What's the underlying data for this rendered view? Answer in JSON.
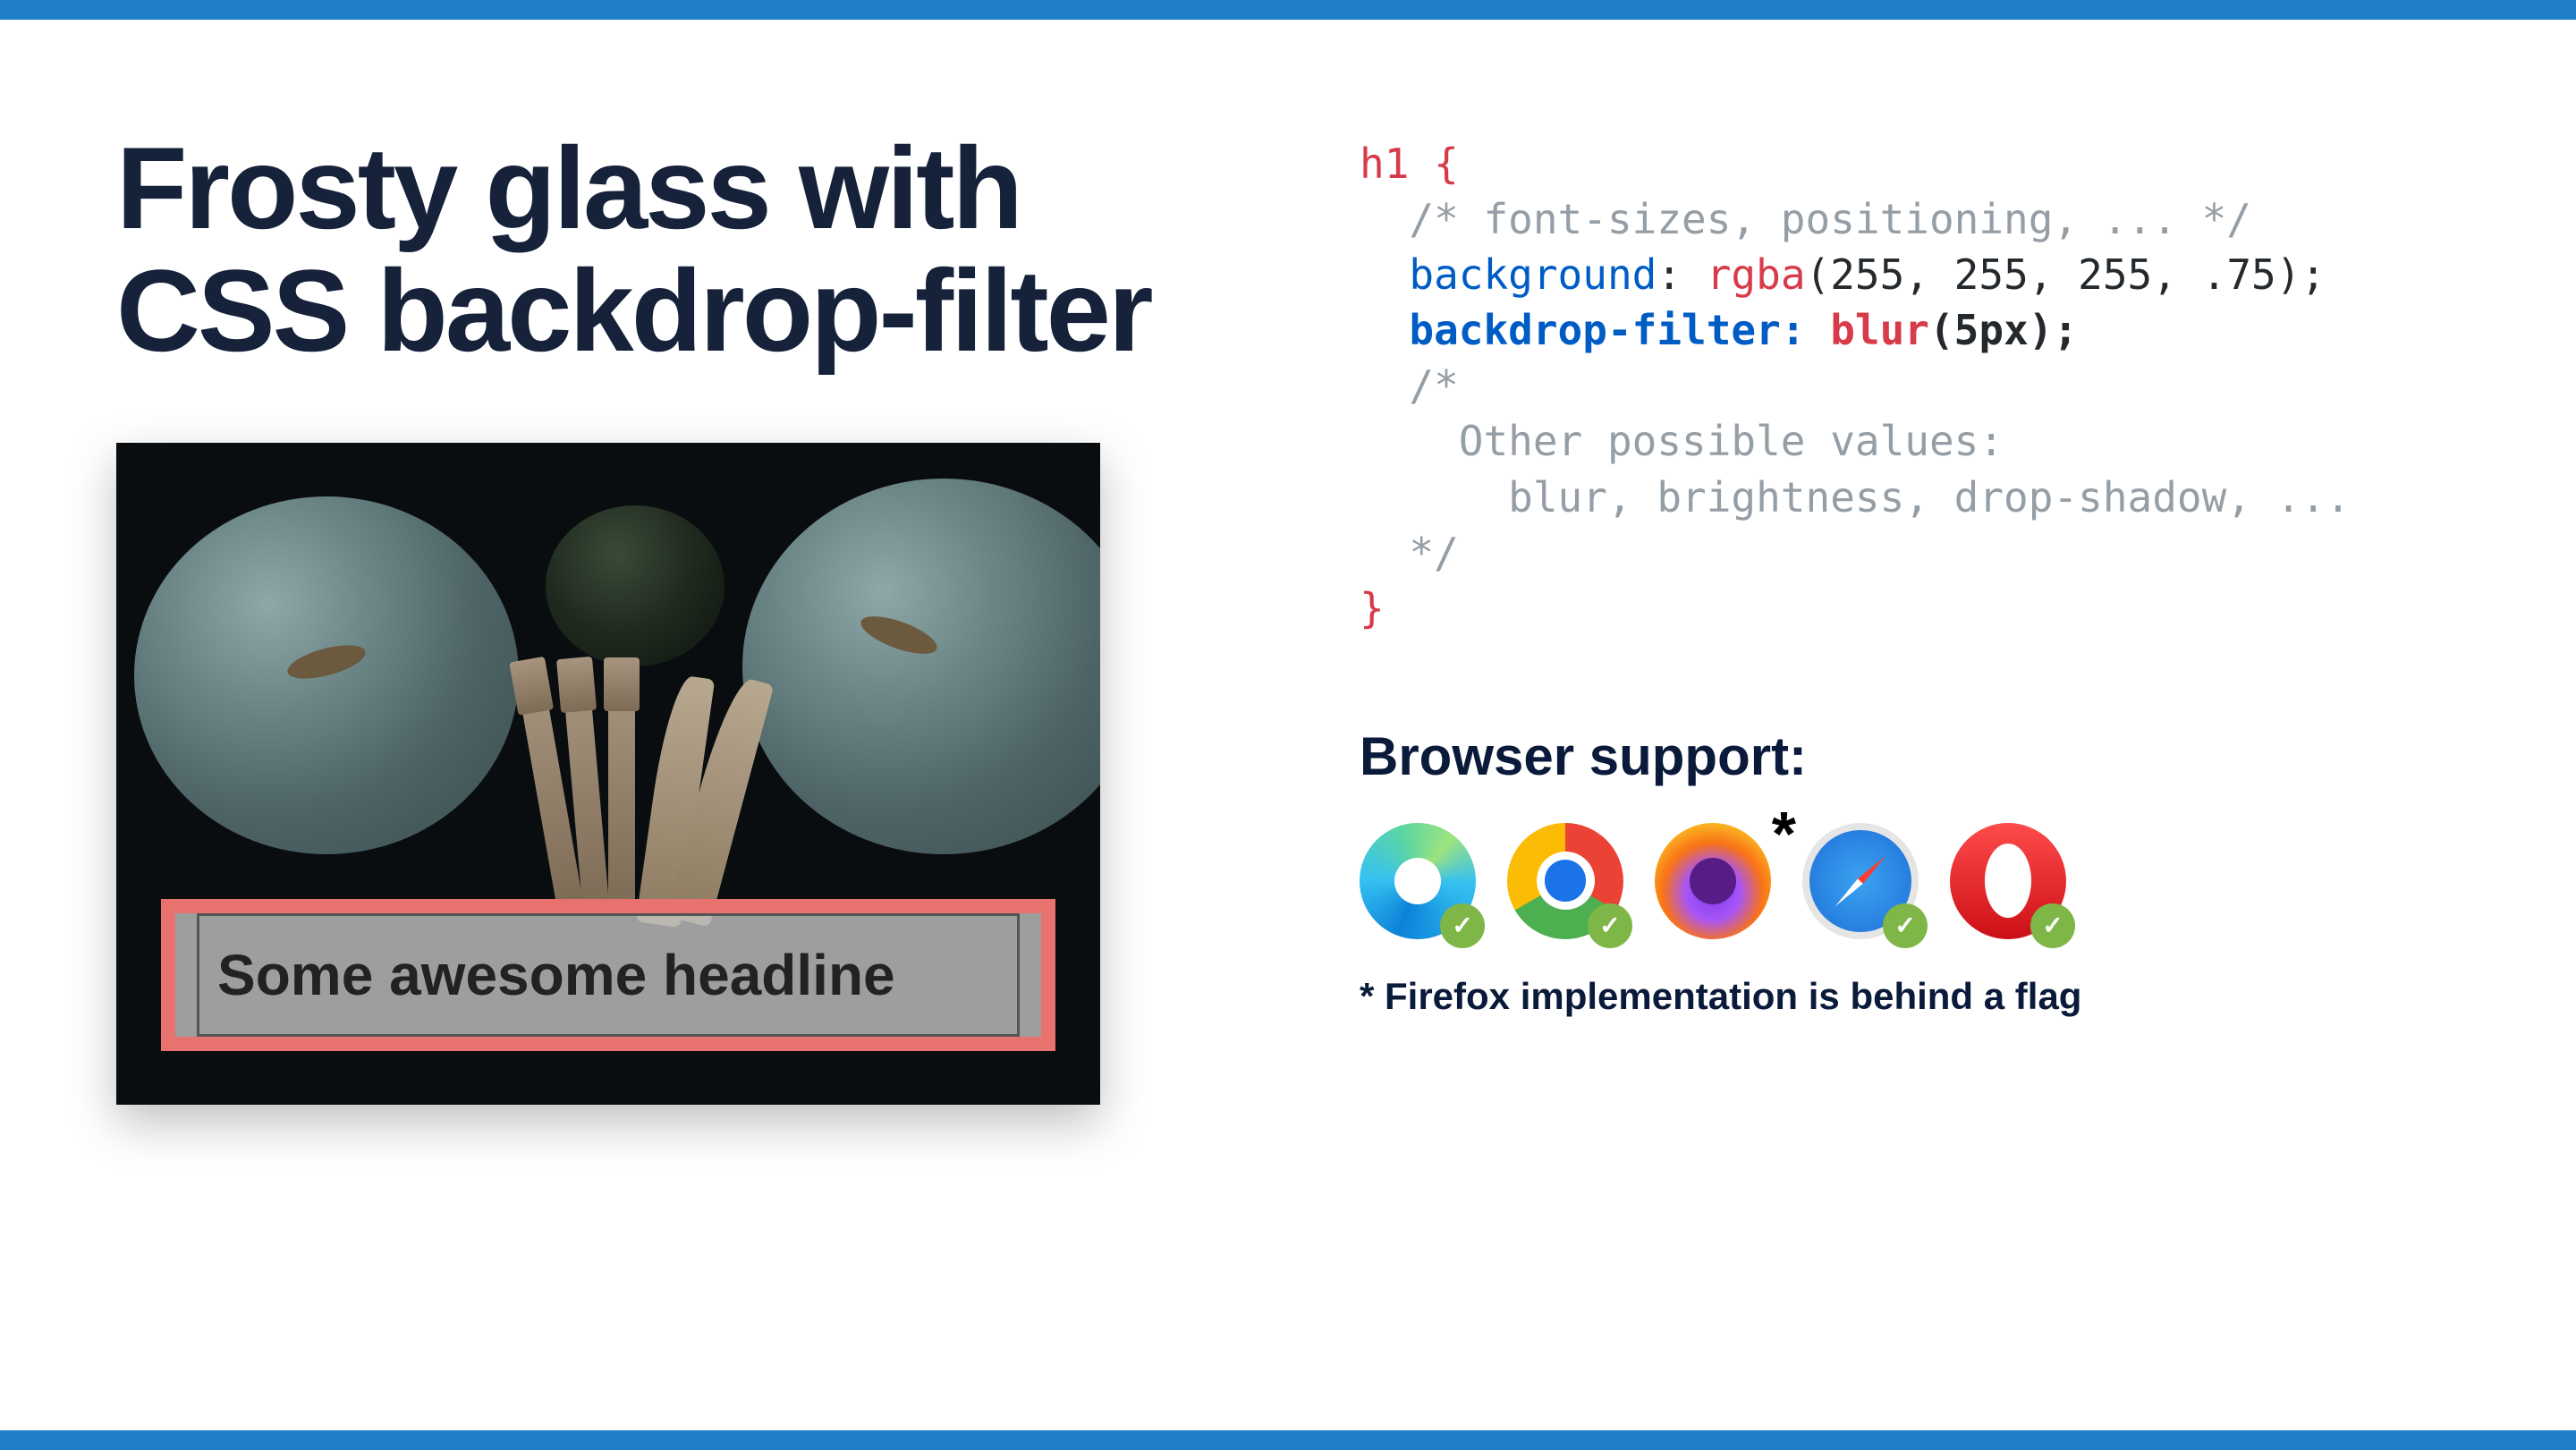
{
  "title_line1": "Frosty glass with",
  "title_line2": "CSS backdrop-filter",
  "banner_text": "Some awesome headline",
  "code": {
    "selector": "h1",
    "comment1": "/* font-sizes, positioning, ... */",
    "prop1": "background",
    "func1": "rgba",
    "args1": "(255, 255, 255, .75);",
    "prop2": "backdrop-filter",
    "func2": "blur",
    "args2": "(5px);",
    "comment2_open": "/*",
    "comment2_l1": "Other possible values:",
    "comment2_l2": "blur, brightness, drop-shadow, ...",
    "comment2_close": "*/"
  },
  "support_heading": "Browser support:",
  "browsers": [
    {
      "name": "edge",
      "supported": true,
      "asterisk": false
    },
    {
      "name": "chrome",
      "supported": true,
      "asterisk": false
    },
    {
      "name": "firefox",
      "supported": false,
      "asterisk": true
    },
    {
      "name": "safari",
      "supported": true,
      "asterisk": false
    },
    {
      "name": "opera",
      "supported": true,
      "asterisk": false
    }
  ],
  "footnote": "* Firefox implementation is behind a flag",
  "asterisk": "*"
}
